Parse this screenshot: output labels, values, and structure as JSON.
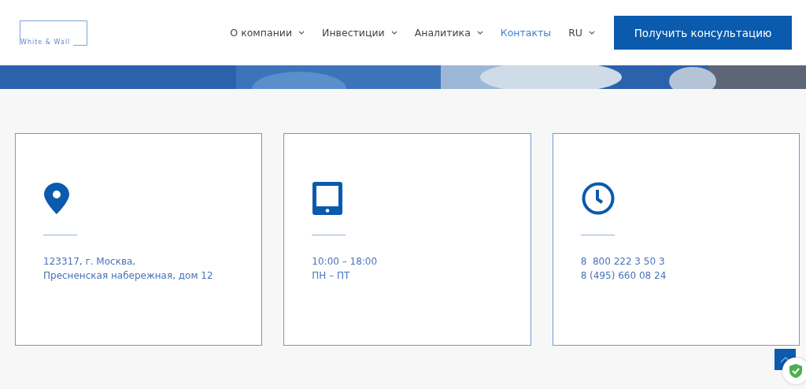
{
  "logo": {
    "text": "White & Wall"
  },
  "nav": [
    {
      "label": "О компании",
      "dropdown": true,
      "selected": false
    },
    {
      "label": "Инвестиции",
      "dropdown": true,
      "selected": false
    },
    {
      "label": "Аналитика",
      "dropdown": true,
      "selected": false
    },
    {
      "label": "Контакты",
      "dropdown": false,
      "selected": true
    },
    {
      "label": "RU",
      "dropdown": true,
      "selected": false
    }
  ],
  "cta_button": "Получить консультацию",
  "cards": [
    {
      "kind": "location",
      "lines": [
        "123317, г. Москва,",
        "Пресненская набережная, дом 12"
      ]
    },
    {
      "kind": "tablet",
      "lines": [
        "10:00 – 18:00",
        "ПН – ПТ"
      ]
    },
    {
      "kind": "clock",
      "lines": [
        "8  800 222 3 50 3",
        "8 (495) 660 08 24"
      ]
    }
  ]
}
